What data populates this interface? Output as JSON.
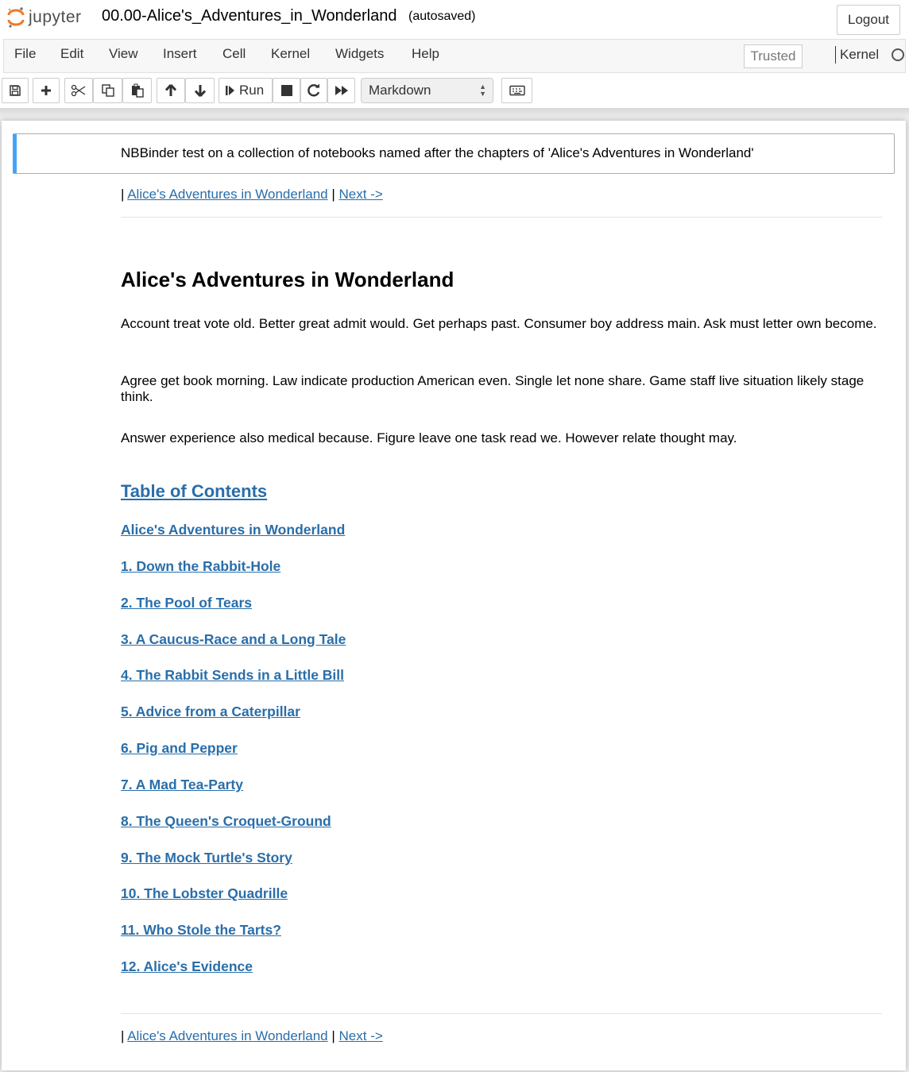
{
  "header": {
    "logo_text": "jupyter",
    "notebook_title": "00.00-Alice's_Adventures_in_Wonderland",
    "autosave_status": "(autosaved)",
    "logout_label": "Logout"
  },
  "menubar": {
    "items": [
      "File",
      "Edit",
      "View",
      "Insert",
      "Cell",
      "Kernel",
      "Widgets",
      "Help"
    ],
    "trusted_label": "Trusted",
    "kernel_label": "Kernel"
  },
  "toolbar": {
    "run_label": "Run",
    "cell_type": "Markdown"
  },
  "notebook": {
    "first_cell_text": "NBBinder test on a collection of notebooks named after the chapters of 'Alice's Adventures in Wonderland'",
    "nav_top": {
      "separator": "|",
      "home_link": "Alice's Adventures in Wonderland",
      "next_link": "Next ->"
    },
    "heading": "Alice's Adventures in Wonderland",
    "paragraphs": [
      "Account treat vote old. Better great admit would. Get perhaps past. Consumer boy address main. Ask must letter own become.",
      "Agree get book morning. Law indicate production American even. Single let none share. Game staff live situation likely stage think.",
      "Answer experience also medical because. Figure leave one task read we. However relate thought may."
    ],
    "toc_title": "Table of Contents",
    "toc_items": [
      "Alice's Adventures in Wonderland",
      "1. Down the Rabbit-Hole",
      "2. The Pool of Tears",
      "3. A Caucus-Race and a Long Tale",
      "4. The Rabbit Sends in a Little Bill",
      "5. Advice from a Caterpillar",
      "6. Pig and Pepper",
      "7. A Mad Tea-Party",
      "8. The Queen's Croquet-Ground",
      "9. The Mock Turtle's Story",
      "10. The Lobster Quadrille",
      "11. Who Stole the Tarts?",
      "12. Alice's Evidence"
    ],
    "nav_bottom": {
      "separator": "|",
      "home_link": "Alice's Adventures in Wonderland",
      "next_link": "Next ->"
    }
  },
  "colors": {
    "link": "#296eaa",
    "selected_cell_border": "#42a5f5",
    "logo_orange": "#f37726"
  }
}
